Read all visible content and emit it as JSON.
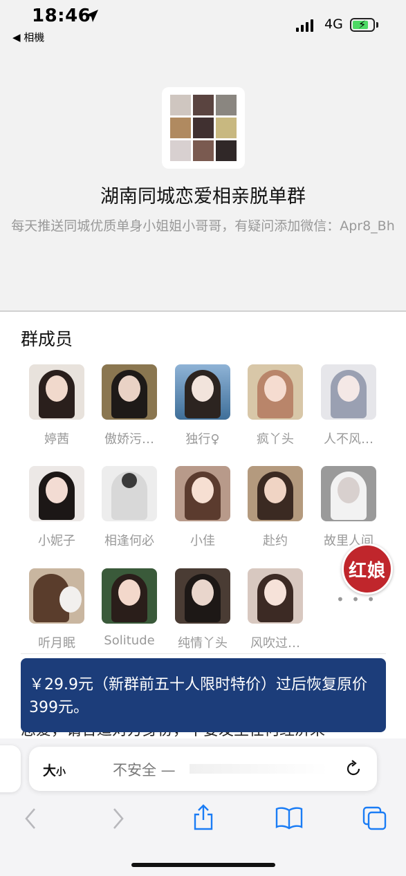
{
  "status_bar": {
    "time": "18:46",
    "back_app": "◀ 相機",
    "network": "4G"
  },
  "group": {
    "title": "湖南同城恋爱相亲脱单群",
    "description": "每天推送同城优质单身小姐姐小哥哥，有疑问添加微信：Apr8_Bh"
  },
  "members_section": {
    "title": "群成员",
    "members": [
      {
        "name": "婷茜"
      },
      {
        "name": "傲娇污…"
      },
      {
        "name": "独行♀"
      },
      {
        "name": "疯丫头"
      },
      {
        "name": "人不风…"
      },
      {
        "name": "小妮子"
      },
      {
        "name": "相逢何必"
      },
      {
        "name": "小佳"
      },
      {
        "name": "赴约"
      },
      {
        "name": "故里人间"
      },
      {
        "name": "听月眠"
      },
      {
        "name": "Solitude"
      },
      {
        "name": "纯情丫头"
      },
      {
        "name": "风吹过…"
      }
    ],
    "more": "• • •"
  },
  "floating_badge": {
    "label": "红娘"
  },
  "banner": {
    "text": "￥29.9元（新群前五十人限时特价）过后恢复原价399元。"
  },
  "partial_text": "恋爱，请合适对方身份，不要发生任何经济来",
  "safari": {
    "text_size_label": "大",
    "text_size_small": "小",
    "address": "不安全 —"
  },
  "colors": {
    "banner": "#1c3d7a",
    "badge": "#c0262c",
    "link_blue": "#1a7cf5"
  }
}
